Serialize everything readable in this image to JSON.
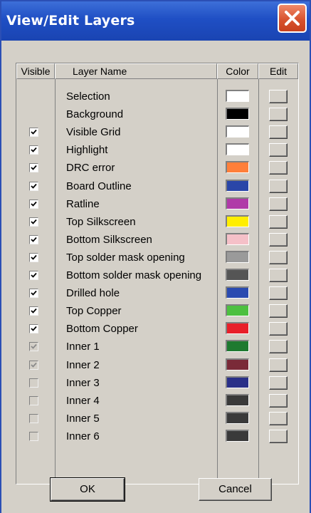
{
  "window": {
    "title": "View/Edit Layers"
  },
  "columns": {
    "visible": "Visible",
    "layer_name": "Layer Name",
    "color": "Color",
    "edit": "Edit"
  },
  "layers": [
    {
      "name": "Selection",
      "checkbox": "none",
      "color": "#ffffff"
    },
    {
      "name": "Background",
      "checkbox": "none",
      "color": "#000000"
    },
    {
      "name": "Visible Grid",
      "checkbox": "checked",
      "color": "#ffffff"
    },
    {
      "name": "Highlight",
      "checkbox": "checked",
      "color": "#ffffff"
    },
    {
      "name": "DRC error",
      "checkbox": "checked",
      "color": "#ff7f3a"
    },
    {
      "name": "Board Outline",
      "checkbox": "checked",
      "color": "#2a46a8"
    },
    {
      "name": "Ratline",
      "checkbox": "checked",
      "color": "#b03aa8"
    },
    {
      "name": "Top Silkscreen",
      "checkbox": "checked",
      "color": "#ffee00"
    },
    {
      "name": "Bottom Silkscreen",
      "checkbox": "checked",
      "color": "#f5c0c8"
    },
    {
      "name": "Top solder mask opening",
      "checkbox": "checked",
      "color": "#9a9a9a"
    },
    {
      "name": "Bottom solder mask opening",
      "checkbox": "checked",
      "color": "#555555"
    },
    {
      "name": "Drilled hole",
      "checkbox": "checked",
      "color": "#2a4ab0"
    },
    {
      "name": "Top Copper",
      "checkbox": "checked",
      "color": "#4dc040"
    },
    {
      "name": "Bottom Copper",
      "checkbox": "checked",
      "color": "#e8202a"
    },
    {
      "name": "Inner 1",
      "checkbox": "checked-disabled",
      "color": "#1e7a30"
    },
    {
      "name": "Inner 2",
      "checkbox": "checked-disabled",
      "color": "#7a2a38"
    },
    {
      "name": "Inner 3",
      "checkbox": "unchecked-disabled",
      "color": "#2a3088"
    },
    {
      "name": "Inner 4",
      "checkbox": "unchecked-disabled",
      "color": "#3a3a3a"
    },
    {
      "name": "Inner 5",
      "checkbox": "unchecked-disabled",
      "color": "#3a3a3a"
    },
    {
      "name": "Inner 6",
      "checkbox": "unchecked-disabled",
      "color": "#3a3a3a"
    }
  ],
  "buttons": {
    "ok": "OK",
    "cancel": "Cancel"
  },
  "icons": {
    "close": "close-icon",
    "check": "checkmark-icon"
  },
  "colors": {
    "title_bar": "#1f4fc4",
    "close_button": "#d8532e",
    "dialog_bg": "#d4d0c8"
  }
}
